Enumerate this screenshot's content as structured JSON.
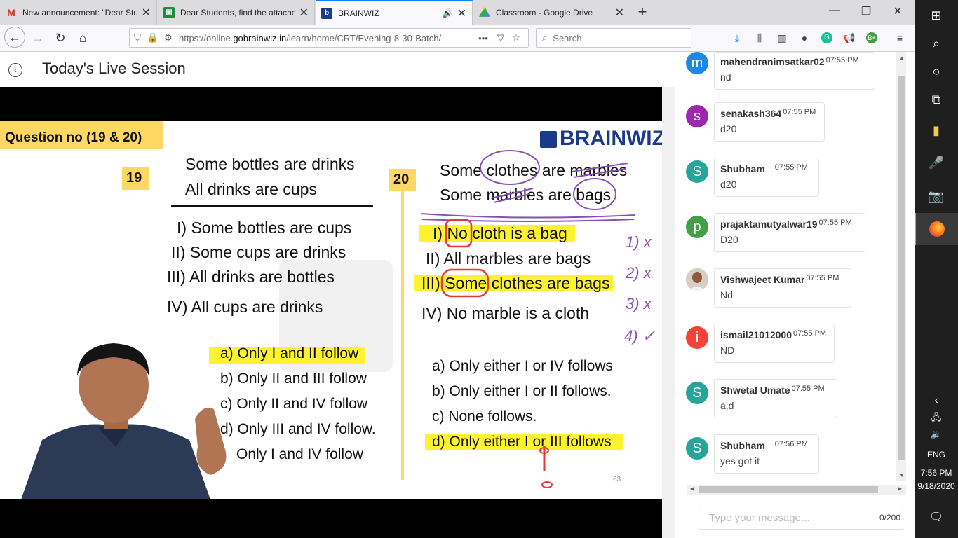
{
  "browser": {
    "tabs": [
      {
        "title": "New announcement: \"Dear Stu",
        "icon": "gmail-icon"
      },
      {
        "title": "Dear Students, find the attache",
        "icon": "classroom-icon"
      },
      {
        "title": "BRAINWIZ",
        "icon": "brainwiz-icon",
        "active": true
      },
      {
        "title": "Classroom - Google Drive",
        "icon": "drive-icon"
      }
    ],
    "url_prefix": "https://online.",
    "url_domain": "gobrainwiz.in",
    "url_path": "/learn/home/CRT/Evening-8-30-Batch/",
    "url_more": "•••",
    "search_placeholder": "Search"
  },
  "page": {
    "title": "Today's Live Session"
  },
  "slide": {
    "heading": "Question no (19 & 20)",
    "brand": "BRAINWIZ",
    "q19": {
      "number": "19",
      "premises": [
        "Some bottles are drinks",
        "All drinks are cups"
      ],
      "conclusions": [
        "I) Some bottles are cups",
        "II) Some cups are drinks",
        "III) All drinks are bottles",
        "IV) All cups are drinks"
      ],
      "options": [
        "a) Only I and II follow",
        "b) Only II and III follow",
        "c) Only II and IV follow",
        "d) Only III and IV follow.",
        "Only I and IV follow"
      ]
    },
    "q20": {
      "number": "20",
      "premises": [
        "Some clothes are marbles",
        "Some marbles are bags"
      ],
      "conclusions": [
        "I) No cloth is a bag",
        "II) All marbles are bags",
        "III) Some clothes are bags",
        "IV) No marble is a cloth"
      ],
      "options": [
        "a) Only either I or IV follows",
        "b) Only either I or II follows.",
        "c) None follows.",
        "d) Only either I or III follows"
      ]
    },
    "annotations": [
      "1) x",
      "2) x",
      "3) x",
      "4) ✓"
    ],
    "page_number": "63"
  },
  "chat": {
    "messages": [
      {
        "initial": "m",
        "color": "#1e88e5",
        "user": "mahendranimsatkar02",
        "time": "07:55 PM",
        "text": "nd"
      },
      {
        "initial": "s",
        "color": "#9c27b0",
        "user": "senakash364",
        "time": "07:55 PM",
        "text": "d20"
      },
      {
        "initial": "S",
        "color": "#26a69a",
        "user": "Shubham",
        "time": "07:55 PM",
        "text": "d20"
      },
      {
        "initial": "p",
        "color": "#43a047",
        "user": "prajaktamutyalwar19",
        "time": "07:55 PM",
        "text": "D20"
      },
      {
        "initial": "",
        "color": "#8d6e63",
        "user": "Vishwajeet Kumar",
        "time": "07:55 PM",
        "text": "Nd"
      },
      {
        "initial": "i",
        "color": "#f44336",
        "user": "ismail21012000",
        "time": "07:55 PM",
        "text": "ND"
      },
      {
        "initial": "S",
        "color": "#26a69a",
        "user": "Shwetal Umate",
        "time": "07:55 PM",
        "text": "a,d"
      },
      {
        "initial": "S",
        "color": "#26a69a",
        "user": "Shubham",
        "time": "07:56 PM",
        "text": "yes got it"
      }
    ],
    "input_placeholder": "Type your message...",
    "char_count": "0/200"
  },
  "taskbar": {
    "language": "ENG",
    "time": "7:56 PM",
    "date": "9/18/2020"
  }
}
